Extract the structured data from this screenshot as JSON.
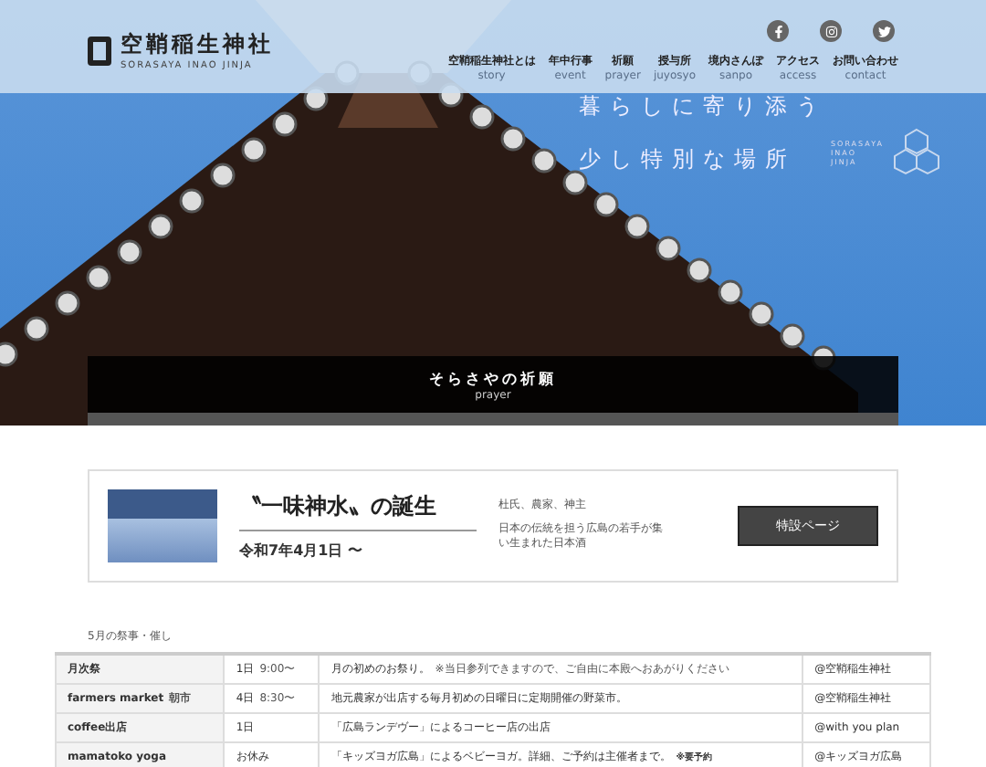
{
  "header": {
    "logo_text": "空鞘稲生神社",
    "logo_sub": "SORASAYA INAO JINJA",
    "nav": [
      {
        "label": "空鞘稲生神社とは",
        "sub": "story"
      },
      {
        "label": "年中行事",
        "sub": "event"
      },
      {
        "label": "祈願",
        "sub": "prayer"
      },
      {
        "label": "授与所",
        "sub": "juyosyo"
      },
      {
        "label": "境内さんぽ",
        "sub": "sanpo"
      },
      {
        "label": "アクセス",
        "sub": "access"
      },
      {
        "label": "お問い合わせ",
        "sub": "contact"
      }
    ]
  },
  "hero": {
    "lines": [
      "暮らしに寄り添う",
      "少し特別な場所"
    ],
    "emblem_text": "SORASAYA INAO JINJA",
    "banner": {
      "title": "そらさやの祈願",
      "sub": "prayer"
    }
  },
  "feature": {
    "title": "〝一味神水〟の誕生",
    "date": "令和7年4月1日 〜",
    "tags": "杜氏、農家、神主",
    "description": "日本の伝統を担う広島の若手が集い生まれた日本酒",
    "button": "特設ページ"
  },
  "events": {
    "heading": "5月の祭事・催し",
    "rows": [
      {
        "name": "月次祭",
        "day": "1日",
        "time": "9:00〜",
        "description": "月の初めのお祭り。",
        "note": "※当日参列できますので、ご自由に本殿へおあがりください",
        "place": "@空鞘稲生神社"
      },
      {
        "name": "farmers market",
        "name_note": "朝市",
        "day": "4日",
        "time": "8:30〜",
        "description": "地元農家が出店する毎月初めの日曜日に定期開催の野菜市。",
        "place": "@空鞘稲生神社"
      },
      {
        "name": "coffee出店",
        "day": "1日",
        "description": "「広島ランデヴー」によるコーヒー店の出店",
        "place": "@with you plan"
      },
      {
        "name": "mamatoko yoga",
        "day": "お休み",
        "description": "「キッズヨガ広島」によるベビーヨガ。詳細、ご予約は主催者まで。",
        "note": "※要予約",
        "place": "@キッズヨガ広島"
      }
    ]
  }
}
